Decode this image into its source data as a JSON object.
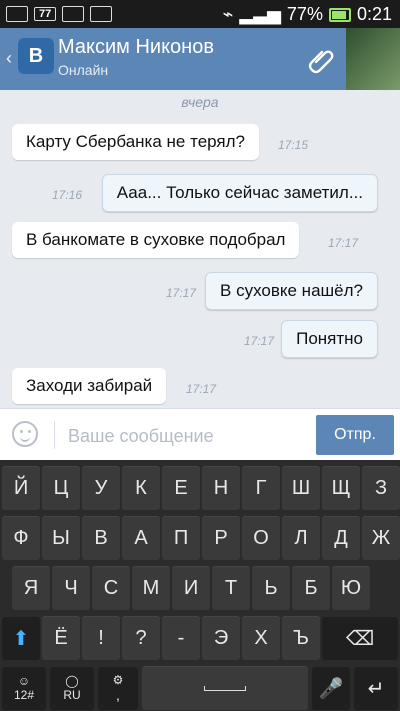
{
  "status_bar": {
    "battery": "77%",
    "time": "0:21",
    "notif_badge": "77"
  },
  "chat": {
    "contact_name": "Максим Никонов",
    "presence": "Онлайн",
    "date_label": "вчера",
    "messages": [
      {
        "text": "Карту Сбербанка не терял?",
        "time": "17:15"
      },
      {
        "text": "Ааа... Только сейчас заметил...",
        "time": "17:16"
      },
      {
        "text": "В банкомате в суховке подобрал",
        "time": "17:17"
      },
      {
        "text": "В суховке нашёл?",
        "time": "17:17"
      },
      {
        "text": "Понятно",
        "time": "17:17"
      },
      {
        "text": "Заходи забирай",
        "time": "17:17"
      }
    ],
    "composer": {
      "placeholder": "Ваше сообщение",
      "send_label": "Отпр."
    }
  },
  "keyboard": {
    "row1": [
      "Й",
      "Ц",
      "У",
      "К",
      "Е",
      "Н",
      "Г",
      "Ш",
      "Щ",
      "З"
    ],
    "row2": [
      "Ф",
      "Ы",
      "В",
      "А",
      "П",
      "Р",
      "О",
      "Л",
      "Д",
      "Ж"
    ],
    "row3": [
      "Я",
      "Ч",
      "С",
      "М",
      "И",
      "Т",
      "Ь",
      "Б",
      "Ю"
    ],
    "row4": [
      "Ё",
      "!",
      "?",
      "-",
      "Э",
      "Х",
      "Ъ"
    ],
    "bottom": {
      "sym": "12#",
      "lang": "RU",
      "comma": ","
    }
  },
  "icons": {
    "back": "chevron-left-icon",
    "vk": "vk-logo",
    "attach": "paperclip-icon",
    "emoji": "smile-icon",
    "shift": "shift-arrow-icon",
    "backspace": "backspace-icon",
    "enter": "enter-icon",
    "mic": "mic-icon",
    "globe": "globe-icon",
    "settings": "gear-icon"
  }
}
